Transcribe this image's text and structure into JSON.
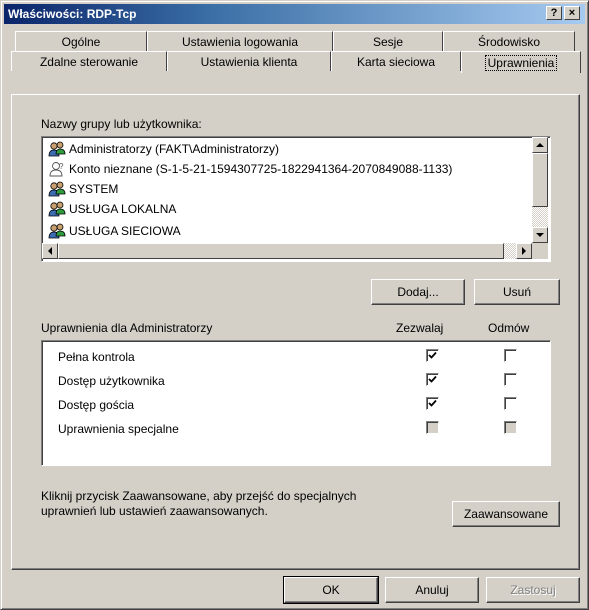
{
  "window": {
    "title": "Właściwości: RDP-Tcp"
  },
  "titlebar": {
    "help_label": "?",
    "close_label": "×"
  },
  "tabs_row1": [
    {
      "label": "Ogólne"
    },
    {
      "label": "Ustawienia logowania"
    },
    {
      "label": "Sesje"
    },
    {
      "label": "Środowisko"
    }
  ],
  "tabs_row2": [
    {
      "label": "Zdalne sterowanie"
    },
    {
      "label": "Ustawienia klienta"
    },
    {
      "label": "Karta sieciowa"
    },
    {
      "label": "Uprawnienia",
      "active": true
    }
  ],
  "users": {
    "label": "Nazwy grupy lub użytkownika:",
    "items": [
      {
        "name": "Administratorzy (FAKT\\Administratorzy)",
        "icon": "group-icon"
      },
      {
        "name": "Konto nieznane (S-1-5-21-1594307725-1822941364-2070849088-1133)",
        "icon": "unknown-user-icon"
      },
      {
        "name": "SYSTEM",
        "icon": "group-icon"
      },
      {
        "name": "USŁUGA LOKALNA",
        "icon": "group-icon"
      },
      {
        "name": "USŁUGA SIECIOWA",
        "icon": "group-icon"
      }
    ]
  },
  "buttons": {
    "add": "Dodaj...",
    "remove": "Usuń",
    "advanced": "Zaawansowane",
    "ok": "OK",
    "cancel": "Anuluj",
    "apply": "Zastosuj"
  },
  "permissions": {
    "label": "Uprawnienia dla Administratorzy",
    "allow_header": "Zezwalaj",
    "deny_header": "Odmów",
    "rows": [
      {
        "name": "Pełna kontrola",
        "allow": true,
        "deny": false,
        "grayed": false
      },
      {
        "name": "Dostęp użytkownika",
        "allow": true,
        "deny": false,
        "grayed": false
      },
      {
        "name": "Dostęp gościa",
        "allow": true,
        "deny": false,
        "grayed": false
      },
      {
        "name": "Uprawnienia specjalne",
        "allow": false,
        "deny": false,
        "grayed": true
      }
    ]
  },
  "advanced_note": {
    "line1": "Kliknij przycisk Zaawansowane, aby przejść do specjalnych",
    "line2": "uprawnień lub ustawień zaawansowanych."
  }
}
